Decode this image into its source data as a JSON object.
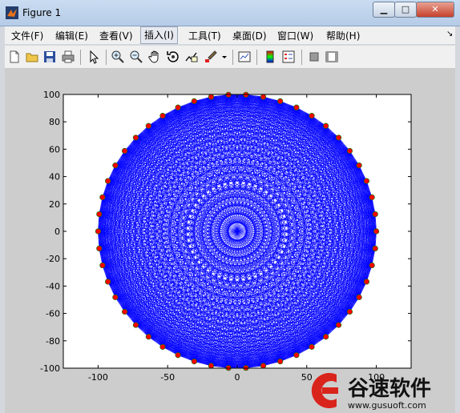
{
  "window": {
    "title": "Figure 1",
    "buttons": {
      "minimize": "▁",
      "maximize": "□",
      "close": "✕"
    }
  },
  "menu": [
    {
      "label": "文件(F)"
    },
    {
      "label": "编辑(E)"
    },
    {
      "label": "查看(V)"
    },
    {
      "label": "插入(I)",
      "selected": true
    },
    {
      "label": "工具(T)"
    },
    {
      "label": "桌面(D)"
    },
    {
      "label": "窗口(W)"
    },
    {
      "label": "帮助(H)"
    }
  ],
  "toolbar": {
    "icons": [
      "new-file-icon",
      "open-folder-icon",
      "save-icon",
      "print-icon",
      "pointer-icon",
      "zoom-in-icon",
      "zoom-out-icon",
      "pan-hand-icon",
      "rotate-3d-icon",
      "data-cursor-icon",
      "brush-icon",
      "link-plot-icon",
      "colorbar-icon",
      "legend-icon",
      "hide-plot-tools-icon",
      "show-plot-tools-icon"
    ]
  },
  "colors": {
    "fill": "#0000ff",
    "marker": "#ff0000",
    "axis_bg": "#ffffff",
    "figure_bg": "#cdcdcd"
  },
  "chart_data": {
    "type": "scatter",
    "title": "",
    "xlabel": "",
    "ylabel": "",
    "xlim": [
      -125,
      125
    ],
    "ylim": [
      -100,
      100
    ],
    "xticks": [
      -100,
      -50,
      0,
      50,
      100
    ],
    "xtick_labels": [
      "-100",
      "-50",
      "0",
      "50",
      "100"
    ],
    "yticks": [
      100,
      80,
      60,
      40,
      20,
      0,
      -20,
      -40,
      -60,
      -80,
      -100
    ],
    "ytick_labels": [
      "100",
      "80",
      "60",
      "40",
      "20",
      "0",
      "-20",
      "-40",
      "-60",
      "-80",
      "-100"
    ],
    "series": [
      {
        "style": "lines",
        "color": "#0000ff",
        "description": "complete graph connecting all points on circle of radius 100",
        "radius": 100,
        "num_points": 50
      },
      {
        "style": "markers",
        "color": "#ff0000",
        "marker": "circle-filled",
        "radius": 100,
        "num_points": 50
      }
    ],
    "grid": false
  },
  "watermark": {
    "text": "谷速软件",
    "url": "www.gusuoft.com"
  }
}
